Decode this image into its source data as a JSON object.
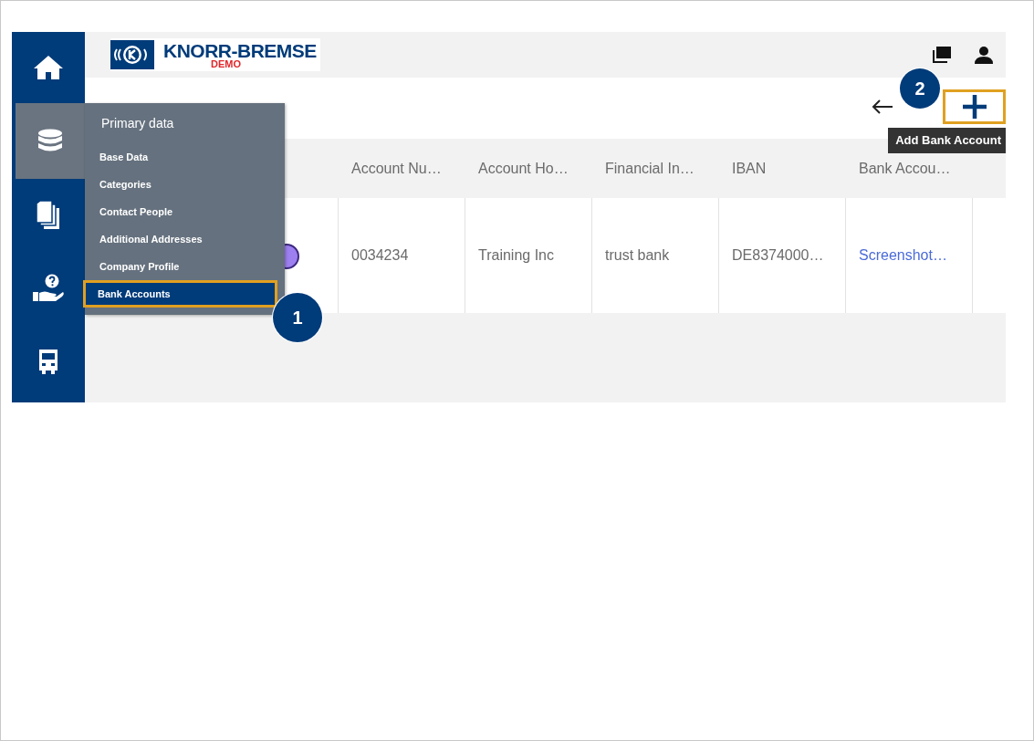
{
  "sidebar": {
    "items": [
      {
        "kind": "home",
        "selected": false
      },
      {
        "kind": "database",
        "selected": true
      },
      {
        "kind": "documents",
        "selected": false
      },
      {
        "kind": "help",
        "selected": false
      },
      {
        "kind": "truck",
        "selected": false
      }
    ]
  },
  "header": {
    "logo": {
      "name": "KNORR-BREMSE",
      "badge": "DEMO"
    }
  },
  "toolbar": {
    "add_button": {
      "highlighted": true,
      "tooltip": "Add Bank Account",
      "callout": "2"
    }
  },
  "table": {
    "columns": [
      "Account Nu…",
      "Account Ho…",
      "Financial In…",
      "IBAN",
      "Bank Accou…"
    ],
    "rows": [
      {
        "cells": [
          {
            "text": "0034234",
            "kind": "text"
          },
          {
            "text": "Training Inc",
            "kind": "text"
          },
          {
            "text": "trust bank",
            "kind": "text"
          },
          {
            "text": "DE8374000…",
            "kind": "text"
          },
          {
            "text": "Screenshot…",
            "kind": "link"
          }
        ]
      }
    ]
  },
  "menu": {
    "title": "Primary data",
    "items": [
      {
        "label": "Base Data",
        "selected": false,
        "highlighted": false
      },
      {
        "label": "Categories",
        "selected": false,
        "highlighted": false
      },
      {
        "label": "Contact People",
        "selected": false,
        "highlighted": false
      },
      {
        "label": "Additional Addresses",
        "selected": false,
        "highlighted": false
      },
      {
        "label": "Company Profile",
        "selected": false,
        "highlighted": false
      },
      {
        "label": "Bank Accounts",
        "selected": true,
        "highlighted": true,
        "callout": "1"
      }
    ]
  }
}
